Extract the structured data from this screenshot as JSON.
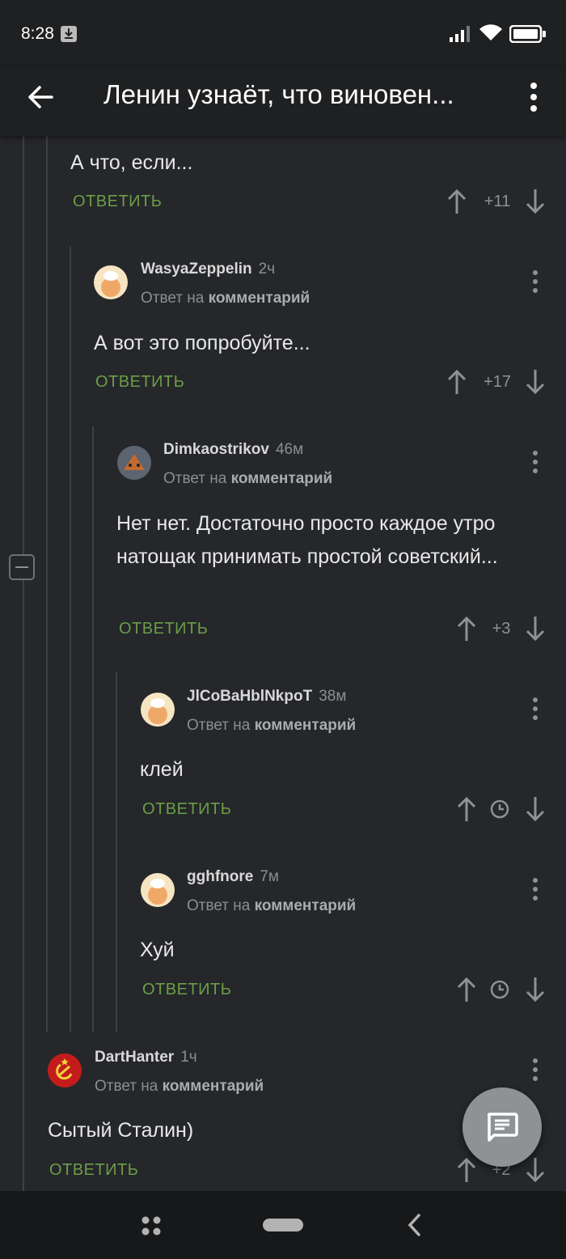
{
  "status": {
    "time": "8:28"
  },
  "app": {
    "title": "Ленин узнаёт, что виновен..."
  },
  "common": {
    "reply_label": "ОТВЕТИТЬ",
    "reply_to_prefix": "Ответ на",
    "reply_to_link": "комментарий"
  },
  "comments": [
    {
      "text": "А что, если...",
      "score": "+11"
    },
    {
      "user": "WasyaZeppelin",
      "time": "2ч",
      "text": "А вот это попробуйте...",
      "score": "+17"
    },
    {
      "user": "Dimkaostrikov",
      "time": "46м",
      "text": "Нет нет. Достаточно просто каждое утро натощак принимать простой советский...",
      "score": "+3"
    },
    {
      "user": "JlCoBaHblNkpoT",
      "time": "38м",
      "text": "клей",
      "score_hidden": true
    },
    {
      "user": "gghfnore",
      "time": "7м",
      "text": "Хуй",
      "score_hidden": true
    },
    {
      "user": "DartHanter",
      "time": "1ч",
      "text": "Сытый Сталин)",
      "score": "+2"
    }
  ],
  "colors": {
    "accent_reply": "#6b9e48",
    "background": "#25272a",
    "bar": "#1f2022"
  },
  "icons": [
    "download-icon",
    "signal-icon",
    "wifi-icon",
    "battery-icon",
    "back-arrow-icon",
    "more-vert-icon",
    "arrow-up-icon",
    "arrow-down-icon",
    "clock-icon",
    "comment-icon",
    "collapse-icon"
  ]
}
